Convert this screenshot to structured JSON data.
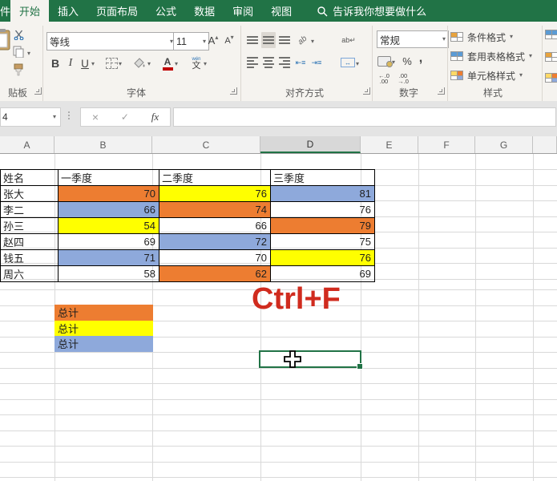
{
  "titlebar": {
    "file_partial": "件",
    "tabs": [
      "开始",
      "插入",
      "页面布局",
      "公式",
      "数据",
      "审阅",
      "视图"
    ],
    "active_tab": "开始",
    "search_text": "告诉我你想要做什么"
  },
  "ribbon": {
    "clipboard": {
      "label": "贴板"
    },
    "font": {
      "label": "字体",
      "font_name": "等线",
      "font_size": "11",
      "grow_letter": "A",
      "shrink_letter": "A",
      "bold": "B",
      "italic": "I",
      "underline": "U",
      "color_letter": "A",
      "phonetic": "文",
      "phonetic_hint": "wén"
    },
    "alignment": {
      "label": "对齐方式",
      "orientation_text": "ab",
      "wrap_text": "ab"
    },
    "number": {
      "label": "数字",
      "format": "常规",
      "percent": "%",
      "comma": ",",
      "inc_decimal": "←.0\n.00",
      "dec_decimal": ".00\n→.0"
    },
    "styles": {
      "label": "样式",
      "items": [
        "条件格式",
        "套用表格格式",
        "单元格样式"
      ]
    }
  },
  "formula_bar": {
    "name_box": "4",
    "cancel": "×",
    "enter": "✓",
    "fx": "fx",
    "value": ""
  },
  "sheet": {
    "columns": [
      "A",
      "B",
      "C",
      "D",
      "E",
      "F",
      "G"
    ],
    "selected_column": "D",
    "table": {
      "headers": [
        "姓名",
        "一季度",
        "二季度",
        "三季度"
      ],
      "rows": [
        {
          "name": "张大",
          "values": [
            {
              "v": "70",
              "bg": "orange"
            },
            {
              "v": "76",
              "bg": "yellow"
            },
            {
              "v": "81",
              "bg": "blue"
            }
          ]
        },
        {
          "name": "李二",
          "values": [
            {
              "v": "66",
              "bg": "blue"
            },
            {
              "v": "74",
              "bg": "orange"
            },
            {
              "v": "76",
              "bg": "none"
            }
          ]
        },
        {
          "name": "孙三",
          "values": [
            {
              "v": "54",
              "bg": "yellow"
            },
            {
              "v": "66",
              "bg": "none"
            },
            {
              "v": "79",
              "bg": "orange"
            }
          ]
        },
        {
          "name": "赵四",
          "values": [
            {
              "v": "69",
              "bg": "none"
            },
            {
              "v": "72",
              "bg": "blue"
            },
            {
              "v": "75",
              "bg": "none"
            }
          ]
        },
        {
          "name": "钱五",
          "values": [
            {
              "v": "71",
              "bg": "blue"
            },
            {
              "v": "70",
              "bg": "none"
            },
            {
              "v": "76",
              "bg": "yellow"
            }
          ]
        },
        {
          "name": "周六",
          "values": [
            {
              "v": "58",
              "bg": "none"
            },
            {
              "v": "62",
              "bg": "orange"
            },
            {
              "v": "69",
              "bg": "none"
            }
          ]
        }
      ]
    },
    "totals": [
      {
        "label": "总计",
        "bg": "orange"
      },
      {
        "label": "总计",
        "bg": "yellow"
      },
      {
        "label": "总计",
        "bg": "blue"
      }
    ],
    "annotation": "Ctrl+F"
  },
  "icons": {
    "search": "magnifier-icon",
    "paste": "clipboard-icon",
    "cut": "scissors-icon",
    "copy": "copy-icon",
    "format_painter": "brush-icon",
    "fill_color": "bucket-icon",
    "selection_cursor": "excel-cross-cursor"
  },
  "colors": {
    "green": "#217346",
    "orange": "#ED7D31",
    "yellow": "#FFFF00",
    "blue": "#8EA9DB",
    "red": "#D02B1E"
  }
}
